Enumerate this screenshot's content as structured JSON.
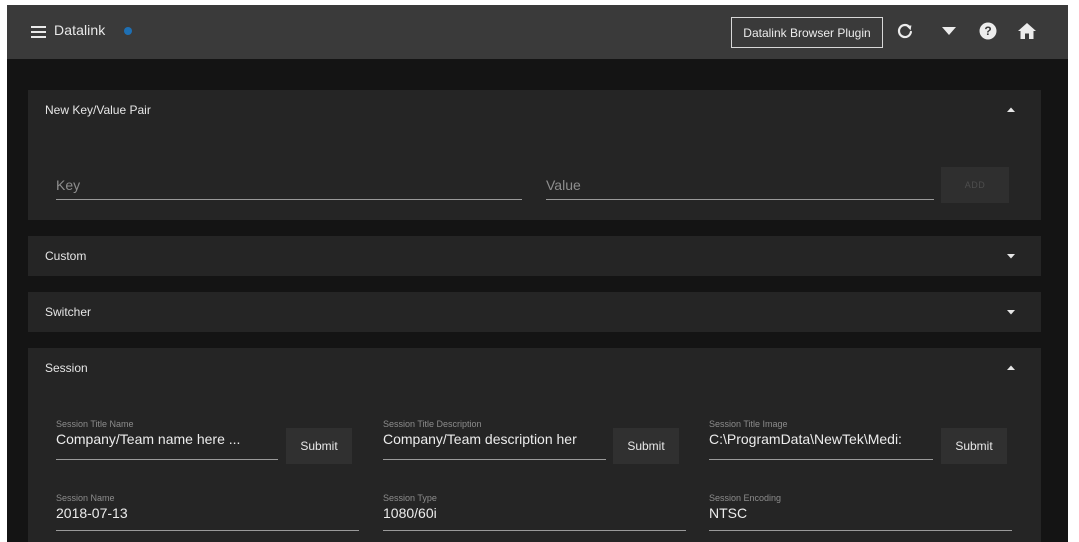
{
  "header": {
    "brand": "Datalink",
    "plugin_button": "Datalink Browser Plugin",
    "icons": [
      "menu-icon",
      "refresh-icon",
      "dropdown-icon",
      "help-icon",
      "home-icon"
    ]
  },
  "new_pair": {
    "title": "New Key/Value Pair",
    "key_placeholder": "Key",
    "value_placeholder": "Value",
    "add_label": "ADD"
  },
  "custom": {
    "title": "Custom"
  },
  "switcher": {
    "title": "Switcher"
  },
  "session": {
    "title": "Session",
    "submit_label": "Submit",
    "title_name": {
      "label": "Session Title Name",
      "value": "Company/Team name here ..."
    },
    "title_description": {
      "label": "Session Title Description",
      "value": "Company/Team description her"
    },
    "title_image": {
      "label": "Session Title Image",
      "value": "C:\\ProgramData\\NewTek\\Medi:"
    },
    "name": {
      "label": "Session Name",
      "value": "2018-07-13"
    },
    "type": {
      "label": "Session Type",
      "value": "1080/60i"
    },
    "encoding": {
      "label": "Session Encoding",
      "value": "NTSC"
    }
  },
  "colors": {
    "topbar": "#3a3a3a",
    "background": "#141414",
    "panel": "#252525",
    "brand_dot": "#1e6fb3"
  }
}
